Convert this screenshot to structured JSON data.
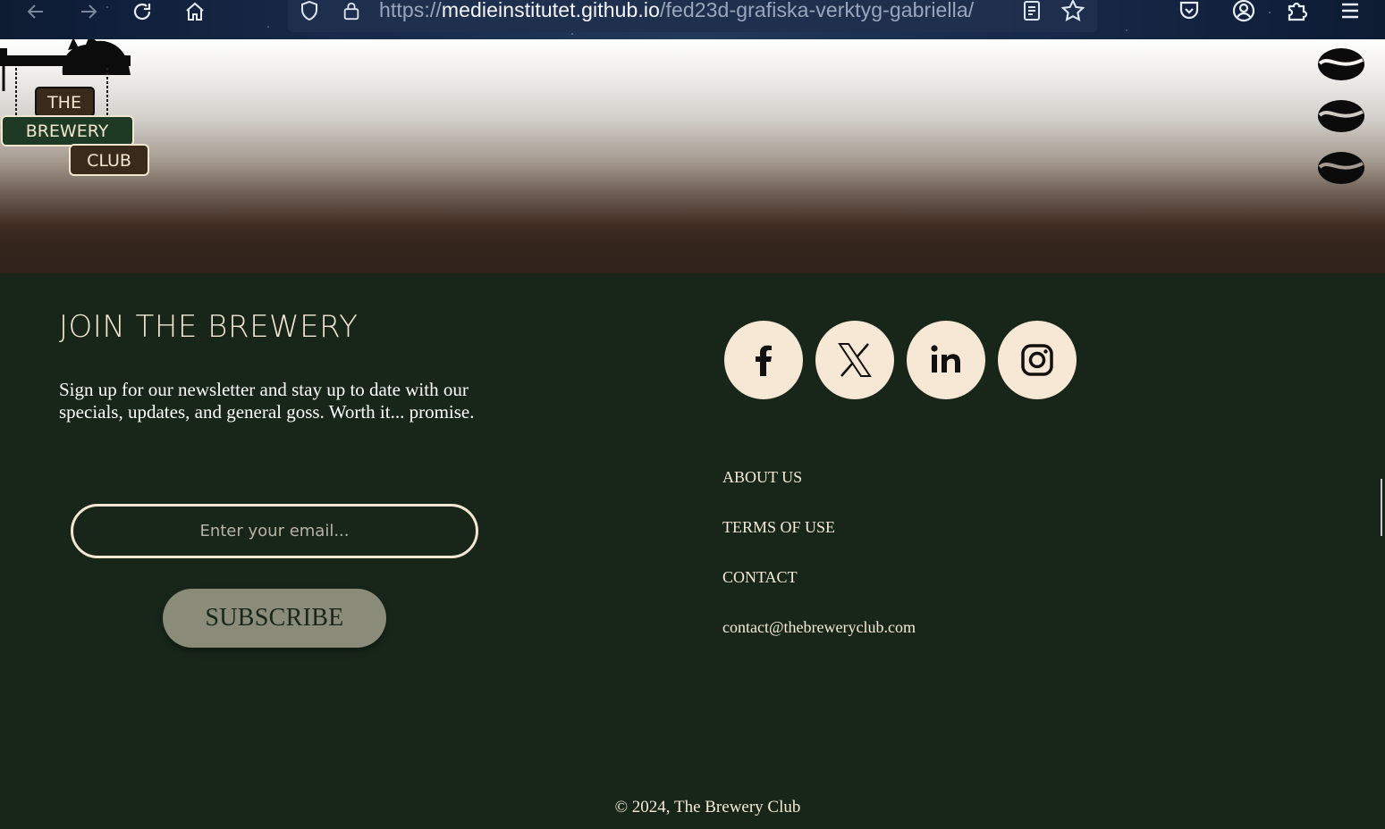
{
  "browser": {
    "url_scheme": "https://",
    "url_host": "medieinstitutet.github.io",
    "url_path": "/fed23d-grafiska-verktyg-gabriella/",
    "icons": [
      "back-icon",
      "forward-icon",
      "reload-icon",
      "home-icon",
      "shield-icon",
      "lock-icon",
      "reader-view-icon",
      "bookmark-star-icon",
      "pocket-icon",
      "account-icon",
      "extensions-icon",
      "menu-icon"
    ]
  },
  "hero": {
    "logo": {
      "line1": "THE",
      "line2": "BREWERY",
      "line3": "CLUB"
    },
    "bean_icons": [
      "coffee-bean-icon",
      "coffee-bean-icon",
      "coffee-bean-icon"
    ]
  },
  "newsletter": {
    "title": "JOIN THE BREWERY",
    "text": "Sign up for our newsletter and stay up to date with our specials, updates, and general goss. Worth it... promise.",
    "email_placeholder": "Enter your email...",
    "subscribe_label": "SUBSCRIBE"
  },
  "social": {
    "icons": [
      "facebook-icon",
      "x-icon",
      "linkedin-icon",
      "instagram-icon"
    ]
  },
  "links": {
    "about": "ABOUT US",
    "terms": "TERMS OF USE",
    "contact": "CONTACT",
    "email": "contact@thebreweryclub.com"
  },
  "footer": {
    "copyright": "© 2024, The Brewery Club"
  },
  "colors": {
    "footer_bg": "#18261a",
    "cream": "#f4e6d2",
    "button_bg": "#8a8c79",
    "hero_bottom": "#32241d"
  }
}
